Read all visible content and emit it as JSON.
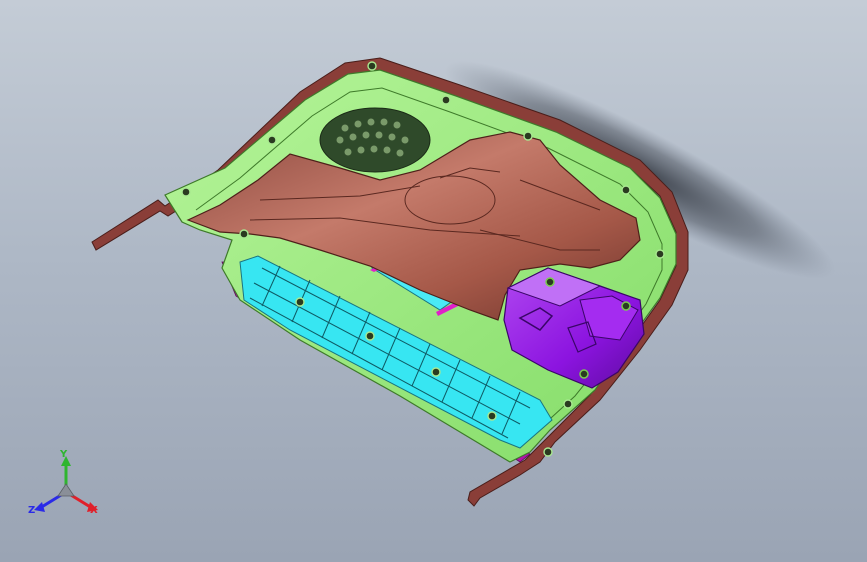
{
  "viewport": {
    "background_top": "#c4ccd6",
    "background_bottom": "#9aa4b4"
  },
  "model": {
    "parts": [
      {
        "name": "outer-rim",
        "color": "#8a3e38"
      },
      {
        "name": "base-housing",
        "color": "#99f07c"
      },
      {
        "name": "top-cover",
        "color": "#b8685a"
      },
      {
        "name": "battery-grid",
        "color": "#37e6f2"
      },
      {
        "name": "electronics-box",
        "color": "#9418e8"
      },
      {
        "name": "vent-grille",
        "color": "#2f4a2a"
      },
      {
        "name": "bottom-edge",
        "color": "#b016a8"
      }
    ]
  },
  "triad": {
    "x_label": "X",
    "y_label": "Y",
    "z_label": "Z",
    "x_color": "#e0202a",
    "y_color": "#2fb52f",
    "z_color": "#2a2ae8"
  }
}
